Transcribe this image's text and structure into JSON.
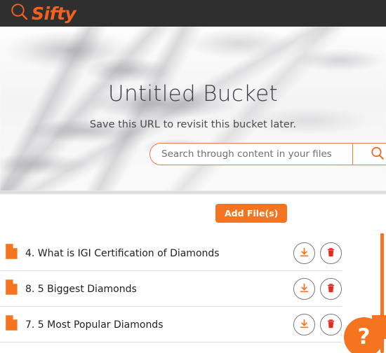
{
  "brand": {
    "name": "Sifty",
    "logo_icon": "search-icon",
    "accent_color": "#f4741f",
    "topbar_color": "#2f2f2f"
  },
  "hero": {
    "title": "Untitled Bucket",
    "subtitle": "Save this URL to revisit this bucket later.",
    "background": "white-marble"
  },
  "search": {
    "value": "",
    "placeholder": "Search through content in your files",
    "button_icon": "search-icon",
    "border_color": "#ef7b3e"
  },
  "toolbar": {
    "add_files_label": "Add File(s)"
  },
  "files": {
    "items": [
      {
        "name": "4. What is IGI Certification of Diamonds",
        "icon": "file-icon",
        "download_icon": "download-icon",
        "delete_icon": "trash-icon"
      },
      {
        "name": "8. 5 Biggest Diamonds",
        "icon": "file-icon",
        "download_icon": "download-icon",
        "delete_icon": "trash-icon"
      },
      {
        "name": "7. 5 Most Popular Diamonds",
        "icon": "file-icon",
        "download_icon": "download-icon",
        "delete_icon": "trash-icon"
      }
    ]
  },
  "help": {
    "label": "?",
    "color": "#f4741f"
  },
  "scrollbar": {
    "color": "#f4741f"
  }
}
